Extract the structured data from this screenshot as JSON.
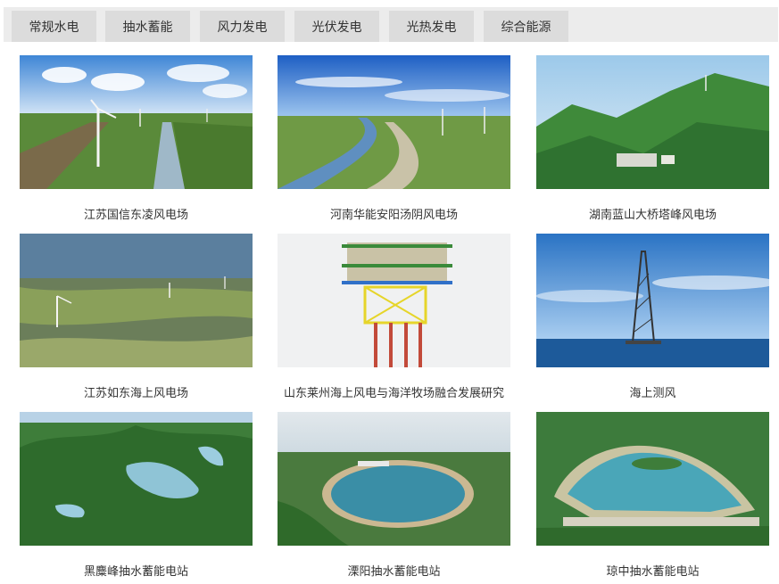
{
  "tabs": [
    {
      "label": "常规水电"
    },
    {
      "label": "抽水蓄能"
    },
    {
      "label": "风力发电"
    },
    {
      "label": "光伏发电"
    },
    {
      "label": "光热发电"
    },
    {
      "label": "综合能源"
    }
  ],
  "projects": [
    {
      "caption": "江苏国信东凌风电场",
      "image": "wind-farm-canal-photo"
    },
    {
      "caption": "河南华能安阳汤阴风电场",
      "image": "wind-farm-river-photo"
    },
    {
      "caption": "湖南蓝山大桥塔峰风电场",
      "image": "mountain-wind-farm-photo"
    },
    {
      "caption": "江苏如东海上风电场",
      "image": "tidal-flat-wind-photo"
    },
    {
      "caption": "山东莱州海上风电与海洋牧场融合发展研究",
      "image": "offshore-platform-render"
    },
    {
      "caption": "海上测风",
      "image": "offshore-met-mast-photo"
    },
    {
      "caption": "黑麋峰抽水蓄能电站",
      "image": "mountain-reservoir-photo"
    },
    {
      "caption": "溧阳抽水蓄能电站",
      "image": "oval-reservoir-photo"
    },
    {
      "caption": "琼中抽水蓄能电站",
      "image": "lake-reservoir-photo"
    }
  ]
}
